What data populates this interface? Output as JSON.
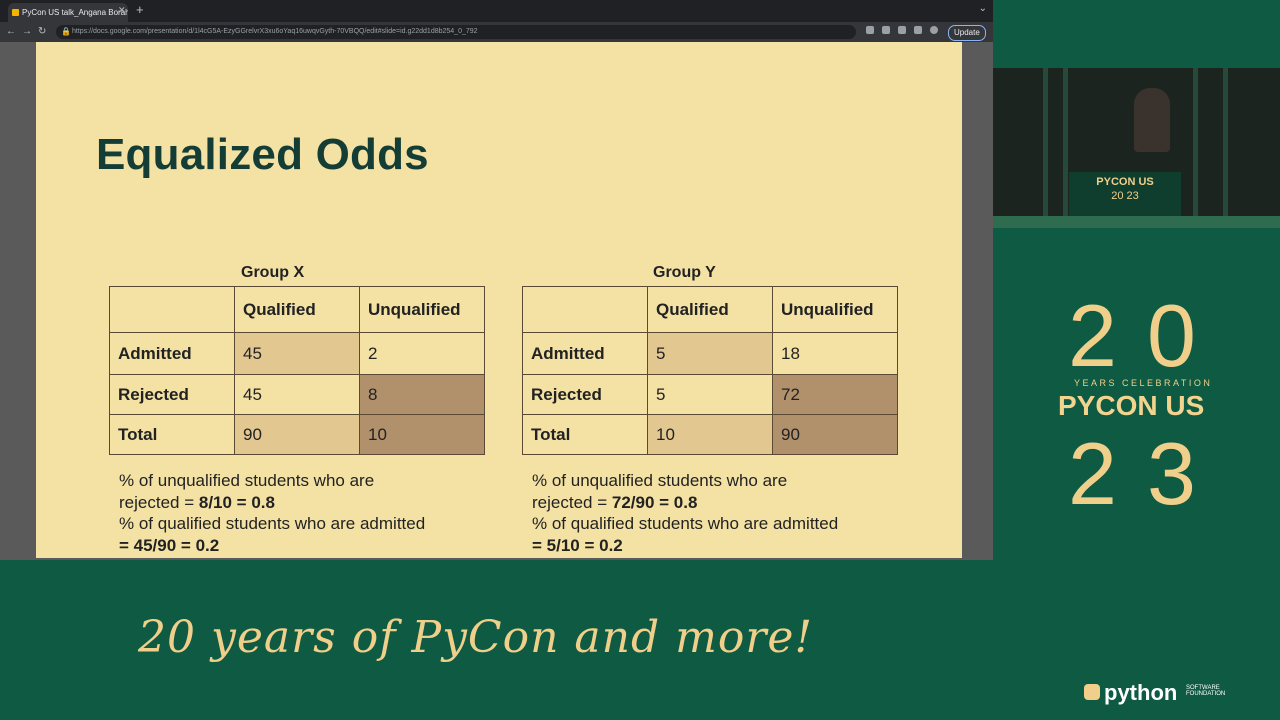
{
  "browser": {
    "tab_title": "PyCon US talk_Angana Borah",
    "new_tab": "+",
    "url": "https://docs.google.com/presentation/d/1l4cG5A-EzyGGrelvrX3xu6oYaq16uwqvGyth-70VBQQ/edit#slide=id.g22dd1d8b254_0_792",
    "update_label": "Update"
  },
  "slide": {
    "title": "Equalized Odds",
    "groups": [
      {
        "label": "Group X",
        "header": [
          "",
          "Qualified",
          "Unqualified"
        ],
        "rows": [
          [
            "Admitted",
            "45",
            "2"
          ],
          [
            "Rejected",
            "45",
            "8"
          ],
          [
            "Total",
            "90",
            "10"
          ]
        ],
        "note_lines": [
          "% of unqualified students who are",
          "rejected = ",
          "8/10 = 0.8",
          "% of qualified students who are admitted",
          "= 45/90 = 0.2"
        ]
      },
      {
        "label": "Group Y",
        "header": [
          "",
          "Qualified",
          "Unqualified"
        ],
        "rows": [
          [
            "Admitted",
            "5",
            "18"
          ],
          [
            "Rejected",
            "5",
            "72"
          ],
          [
            "Total",
            "10",
            "90"
          ]
        ],
        "note_lines": [
          "% of unqualified students who are",
          "rejected = ",
          "72/90 = 0.8",
          "% of qualified students who are admitted",
          "= 5/10 = 0.2"
        ]
      }
    ]
  },
  "event": {
    "podium_title": "PYCON US",
    "podium_year": "20 23",
    "year_top": "20",
    "years_celebration": "YEARS CELEBRATION",
    "brand": "PYCON US",
    "year_bottom": "23",
    "tagline": "20 years of PyCon and more!",
    "psf_word": "python",
    "psf_sub": "SOFTWARE FOUNDATION"
  }
}
